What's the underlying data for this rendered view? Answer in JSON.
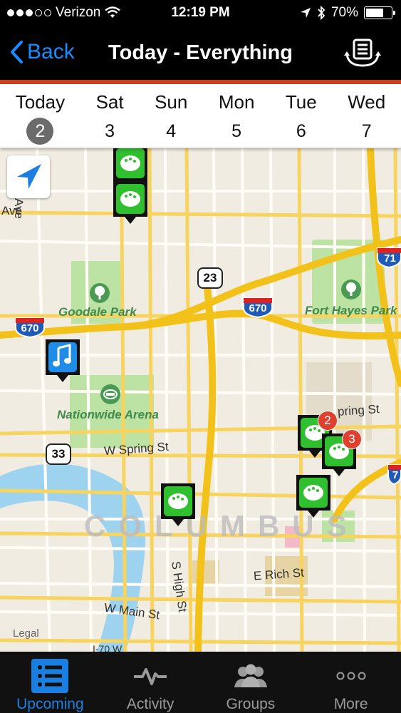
{
  "status_bar": {
    "carrier": "Verizon",
    "time": "12:19 PM",
    "battery_percent": "70%",
    "battery_level": 0.7,
    "icons": [
      "signal-dots",
      "wifi-icon",
      "location-arrow-icon",
      "bluetooth-icon",
      "battery-icon"
    ]
  },
  "nav": {
    "back_label": "Back",
    "title": "Today - Everything",
    "action_icon": "list-refresh-icon"
  },
  "colors": {
    "accent_stripe": "#c8401f",
    "ios_blue": "#1a8cff",
    "pin_green": "#2fbf2f",
    "pin_blue": "#1f8de8",
    "badge_red": "#e04030"
  },
  "days": [
    {
      "name": "Today",
      "num": "2",
      "active": true
    },
    {
      "name": "Sat",
      "num": "3"
    },
    {
      "name": "Sun",
      "num": "4"
    },
    {
      "name": "Mon",
      "num": "5"
    },
    {
      "name": "Tue",
      "num": "6"
    },
    {
      "name": "Wed",
      "num": "7"
    }
  ],
  "map": {
    "labels": {
      "ave_left": "Ave",
      "ave_vertical": "Ave",
      "goodale_park": "Goodale Park",
      "fort_hayes_park": "Fort Hayes Park",
      "nationwide_arena": "Nationwide Arena",
      "w_spring_st": "W Spring St",
      "spring_st_right": "pring St",
      "columbus": "COLUMBUS",
      "s_high_st": "S High St",
      "e_rich_st": "E Rich St",
      "w_main_st": "W Main St",
      "i70w": "I-70 W",
      "legal": "Legal"
    },
    "shields": {
      "us23": "23",
      "us33": "33",
      "i670_left": "670",
      "i670_mid": "670",
      "i71_top": "71",
      "i71_right": "7"
    },
    "pins": [
      {
        "id": "art-1",
        "icon": "palette-icon",
        "color": "green"
      },
      {
        "id": "art-2",
        "icon": "palette-icon",
        "color": "green"
      },
      {
        "id": "music-1",
        "icon": "music-note-icon",
        "color": "blue"
      },
      {
        "id": "art-cluster-2",
        "icon": "palette-icon",
        "color": "green",
        "badge": "2"
      },
      {
        "id": "art-cluster-3",
        "icon": "palette-icon",
        "color": "green",
        "badge": "3"
      },
      {
        "id": "art-3",
        "icon": "palette-icon",
        "color": "green"
      },
      {
        "id": "art-4",
        "icon": "palette-icon",
        "color": "green"
      }
    ]
  },
  "tabs": [
    {
      "label": "Upcoming",
      "icon": "list-icon",
      "active": true
    },
    {
      "label": "Activity",
      "icon": "pulse-icon"
    },
    {
      "label": "Groups",
      "icon": "people-icon"
    },
    {
      "label": "More",
      "icon": "ellipsis-icon"
    }
  ]
}
